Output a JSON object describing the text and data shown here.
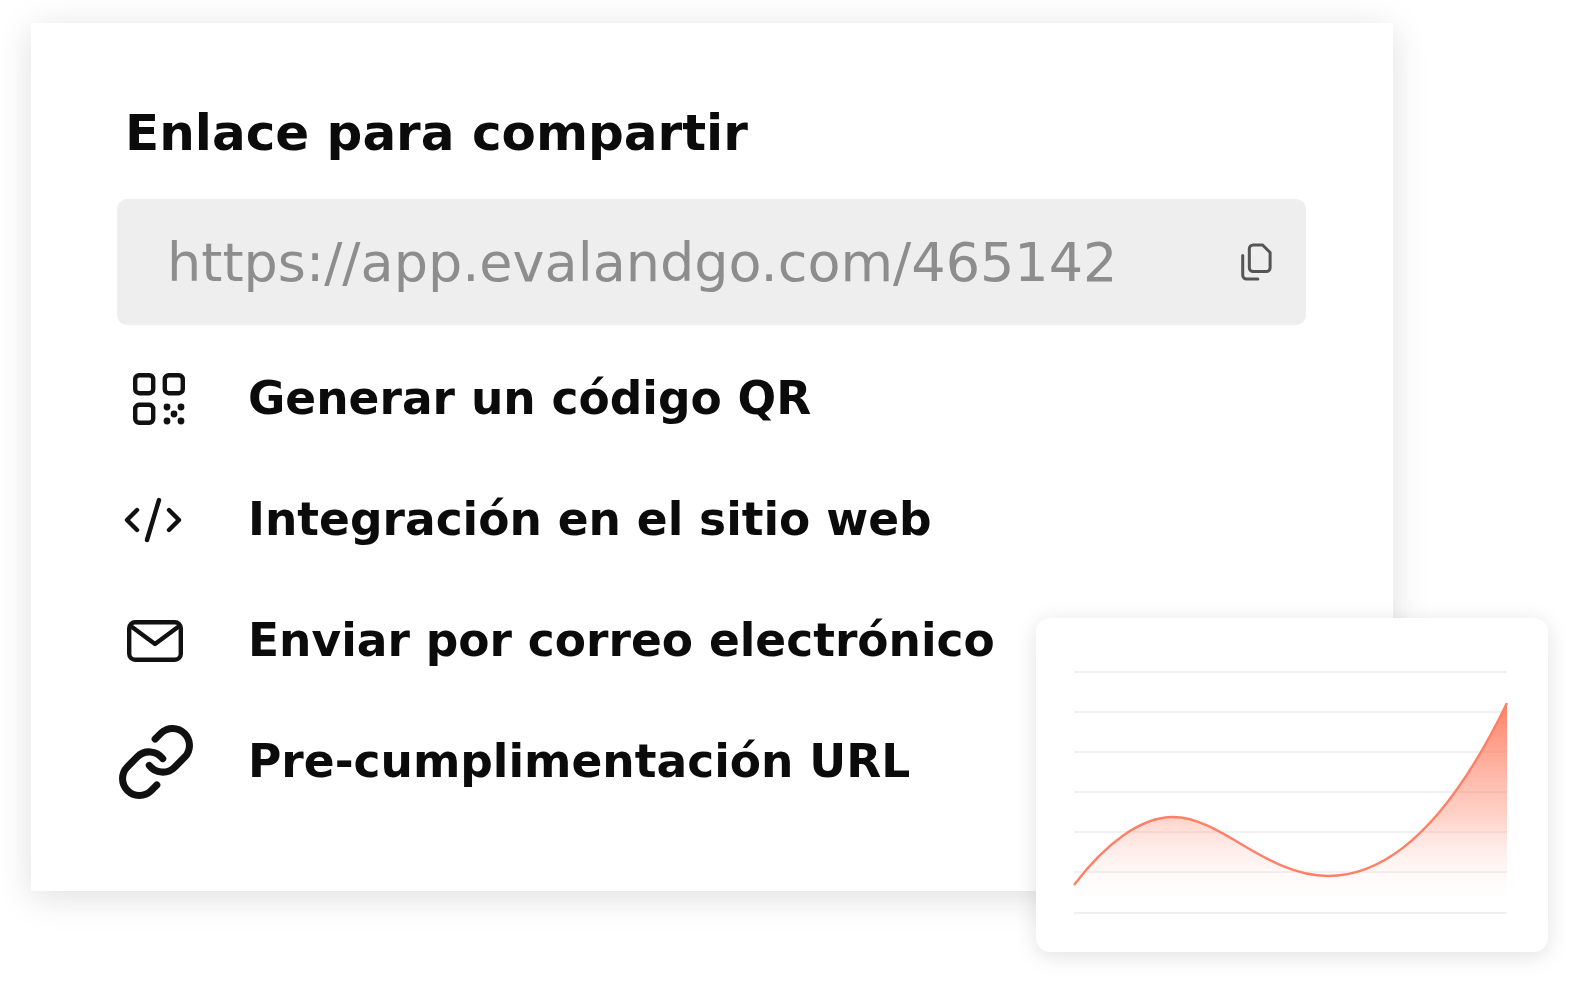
{
  "share_card": {
    "title": "Enlace para compartir",
    "link_field": {
      "value": "https://app.evalandgo.com/465142"
    },
    "options": [
      {
        "kind": "qr",
        "label": "Generar un código QR"
      },
      {
        "kind": "embed",
        "label": "Integración en el sitio web"
      },
      {
        "kind": "email",
        "label": "Enviar por correo electrónico"
      },
      {
        "kind": "link",
        "label": "Pre-cumplimentación URL"
      }
    ]
  }
}
